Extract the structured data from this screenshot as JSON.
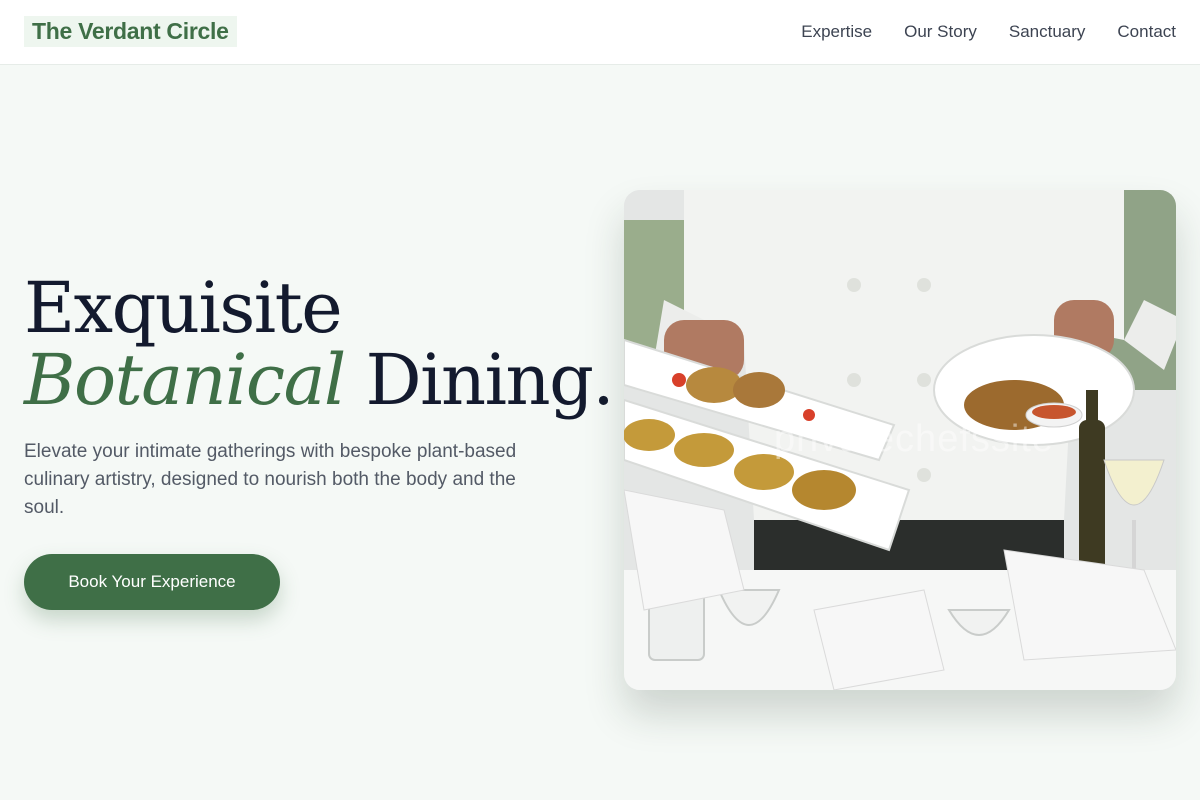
{
  "header": {
    "brand": "The Verdant Circle",
    "nav": [
      "Expertise",
      "Our Story",
      "Sanctuary",
      "Contact"
    ]
  },
  "hero": {
    "headline_line1": "Exquisite",
    "headline_em": "Botanical",
    "headline_rest": " Dining.",
    "subtext": "Elevate your intimate gatherings with bespoke plant-based culinary artistry, designed to nourish both the body and the soul.",
    "cta_label": "Book Your Experience",
    "image_watermark": "privatechefssite"
  },
  "colors": {
    "accent": "#3f6f47",
    "background": "#f5f9f6",
    "heading": "#131a2e",
    "body_text": "#535a66"
  }
}
